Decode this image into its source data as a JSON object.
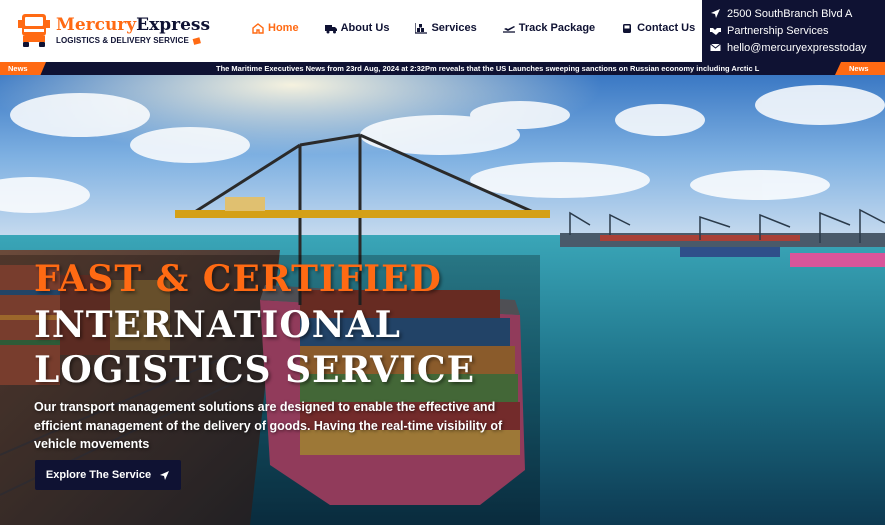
{
  "brand": {
    "name_part1": "Mercury",
    "name_part2": "Express",
    "tagline": "LOGISTICS & DELIVERY SERVICE",
    "accent_color": "#ff6a13",
    "navy_color": "#0f1233"
  },
  "nav": {
    "items": [
      {
        "label": "Home",
        "icon": "home-icon",
        "active": true
      },
      {
        "label": "About Us",
        "icon": "truck-icon",
        "active": false
      },
      {
        "label": "Services",
        "icon": "boxes-icon",
        "active": false
      },
      {
        "label": "Track Package",
        "icon": "plane-icon",
        "active": false
      },
      {
        "label": "Contact Us",
        "icon": "phone-icon",
        "active": false
      }
    ]
  },
  "contact": {
    "address": "2500 SouthBranch Blvd A",
    "partnership": "Partnership Services",
    "email": "hello@mercuryexpresstoday"
  },
  "ticker": {
    "left_tag": "News",
    "right_tag": "News",
    "text": "The Maritime Executives News from 23rd Aug, 2024 at 2:32Pm reveals that the US Launches sweeping sanctions on Russian economy including Arctic L"
  },
  "hero": {
    "title_line1": "FAST & CERTIFIED",
    "title_line2": "INTERNATIONAL",
    "title_line3": "LOGISTICS SERVICE",
    "description": "Our transport management solutions are designed to enable the effective and efficient management of the delivery of goods. Having the real-time visibility of vehicle movements",
    "button_label": "Explore The Service"
  }
}
